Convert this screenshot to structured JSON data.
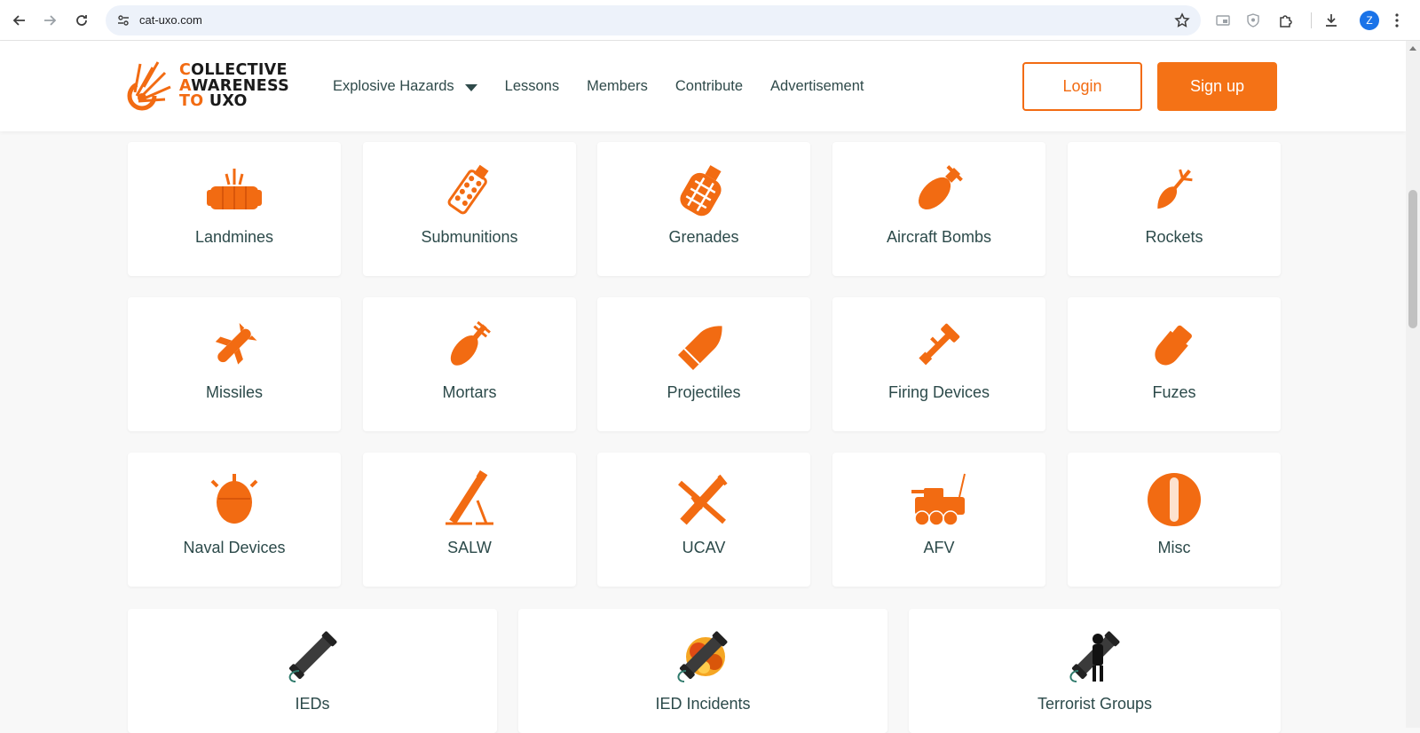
{
  "browser": {
    "url": "cat-uxo.com",
    "profile_initial": "Z"
  },
  "site": {
    "logo_lines": [
      "COLLECTIVE",
      "AWARENESS",
      "TO UXO"
    ],
    "logo_highlight": [
      "C",
      "A",
      "TO"
    ],
    "brand_color": "#f26b12",
    "nav": {
      "explosive_hazards": "Explosive Hazards",
      "lessons": "Lessons",
      "members": "Members",
      "contribute": "Contribute",
      "advertisement": "Advertisement"
    },
    "login_label": "Login",
    "signup_label": "Sign up"
  },
  "categories": [
    {
      "label": "Landmines",
      "icon": "landmine-icon"
    },
    {
      "label": "Submunitions",
      "icon": "submunition-icon"
    },
    {
      "label": "Grenades",
      "icon": "grenade-icon"
    },
    {
      "label": "Aircraft Bombs",
      "icon": "aircraft-bomb-icon"
    },
    {
      "label": "Rockets",
      "icon": "rocket-icon"
    },
    {
      "label": "Missiles",
      "icon": "missile-icon"
    },
    {
      "label": "Mortars",
      "icon": "mortar-icon"
    },
    {
      "label": "Projectiles",
      "icon": "projectile-icon"
    },
    {
      "label": "Firing Devices",
      "icon": "firing-device-icon"
    },
    {
      "label": "Fuzes",
      "icon": "fuze-icon"
    },
    {
      "label": "Naval Devices",
      "icon": "naval-device-icon"
    },
    {
      "label": "SALW",
      "icon": "salw-icon"
    },
    {
      "label": "UCAV",
      "icon": "ucav-icon"
    },
    {
      "label": "AFV",
      "icon": "afv-icon"
    },
    {
      "label": "Misc",
      "icon": "misc-icon"
    }
  ],
  "ied_categories": [
    {
      "label": "IEDs",
      "icon": "ied-pipe-icon"
    },
    {
      "label": "IED Incidents",
      "icon": "ied-incident-icon"
    },
    {
      "label": "Terrorist Groups",
      "icon": "terrorist-group-icon"
    }
  ]
}
